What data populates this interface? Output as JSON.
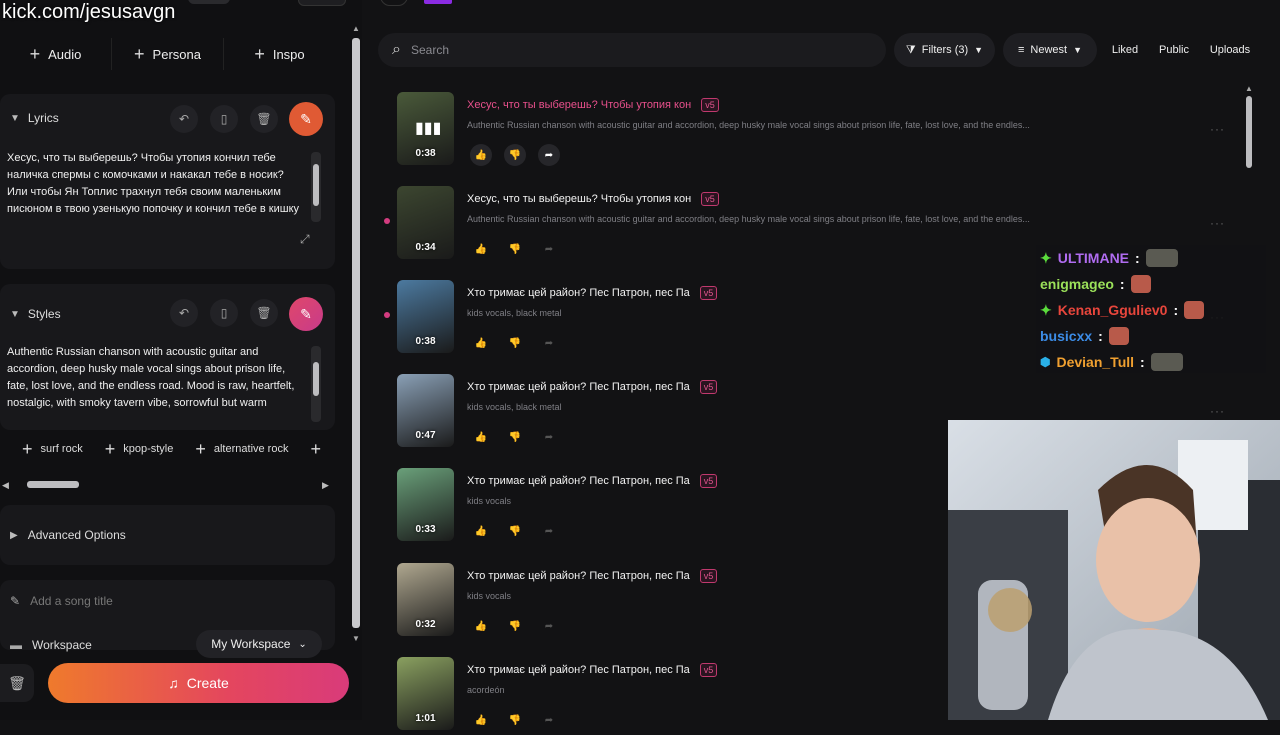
{
  "watermark": "kick.com/jesusavgn",
  "top_buttons": [
    {
      "label": "Audio"
    },
    {
      "label": "Persona"
    },
    {
      "label": "Inspo"
    }
  ],
  "lyrics": {
    "title": "Lyrics",
    "text": "Хесус, что ты выберешь? Чтобы утопия кончил тебе наличка спермы с комочками и накакал тебе в носик? Или чтобы Ян Топлис трахнул тебя своим маленьким писюном в твою узенькую попочку и кончил тебе в кишку"
  },
  "styles": {
    "title": "Styles",
    "text": "Authentic Russian chanson with acoustic guitar and accordion, deep husky male vocal sings about prison life, fate, lost love, and the endless road. Mood is raw, heartfelt, nostalgic, with smoky tavern vibe, sorrowful but warm",
    "tags": [
      "surf rock",
      "kpop-style",
      "alternative rock"
    ]
  },
  "advanced_options": "Advanced Options",
  "song_title_placeholder": "Add a song title",
  "workspace": {
    "label": "Workspace",
    "value": "My Workspace"
  },
  "create_label": "Create",
  "search_placeholder": "Search",
  "filters": {
    "filters": "Filters (3)",
    "sort": "Newest",
    "liked": "Liked",
    "public": "Public",
    "uploads": "Uploads"
  },
  "tracks": [
    {
      "title": "Хесус, что ты выберешь? Чтобы утопия кон",
      "badge": "v5",
      "desc": "Authentic Russian chanson with acoustic guitar and accordion, deep husky male vocal sings about prison life, fate, lost love, and the endles...",
      "duration": "0:38",
      "playing": true,
      "title_color": "#e8508c",
      "cover": "#4a5a3a"
    },
    {
      "title": "Хесус, что ты выберешь? Чтобы утопия кон",
      "badge": "v5",
      "desc": "Authentic Russian chanson with acoustic guitar and accordion, deep husky male vocal sings about prison life, fate, lost love, and the endles...",
      "duration": "0:34",
      "playing": false,
      "title_color": "#f2f2f2",
      "cover": "#3c4630"
    },
    {
      "title": "Хто тримає цей район? Пес Патрон, пес Па",
      "badge": "v5",
      "desc": "kids vocals, black metal",
      "duration": "0:38",
      "playing": false,
      "title_color": "#f2f2f2",
      "cover": "#4c7aa0"
    },
    {
      "title": "Хто тримає цей район? Пес Патрон, пес Па",
      "badge": "v5",
      "desc": "kids vocals, black metal",
      "duration": "0:47",
      "playing": false,
      "title_color": "#f2f2f2",
      "cover": "#8aa0b6"
    },
    {
      "title": "Хто тримає цей район? Пес Патрон, пес Па",
      "badge": "v5",
      "desc": "kids vocals",
      "duration": "0:33",
      "playing": false,
      "title_color": "#f2f2f2",
      "cover": "#6aa07a"
    },
    {
      "title": "Хто тримає цей район? Пес Патрон, пес Па",
      "badge": "v5",
      "desc": "kids vocals",
      "duration": "0:32",
      "playing": false,
      "title_color": "#f2f2f2",
      "cover": "#b0a890"
    },
    {
      "title": "Хто тримає цей район? Пес Патрон, пес Па",
      "badge": "v5",
      "desc": "acordeón",
      "duration": "1:01",
      "playing": false,
      "title_color": "#f2f2f2",
      "cover": "#8aa060"
    }
  ],
  "chat": [
    {
      "name": "ULTIMANE",
      "color": "#b06cf0",
      "badge": "green",
      "emote": "gray"
    },
    {
      "name": "enigmageo",
      "color": "#9be15a",
      "badge": "",
      "emote": "red"
    },
    {
      "name": "Kenan_Gguliev0",
      "color": "#e8463c",
      "badge": "green",
      "emote": "red"
    },
    {
      "name": "busicxx",
      "color": "#3c8ce6",
      "badge": "",
      "emote": "red"
    },
    {
      "name": "Devian_Tull",
      "color": "#f0a030",
      "badge": "blue",
      "emote": "gray"
    }
  ]
}
